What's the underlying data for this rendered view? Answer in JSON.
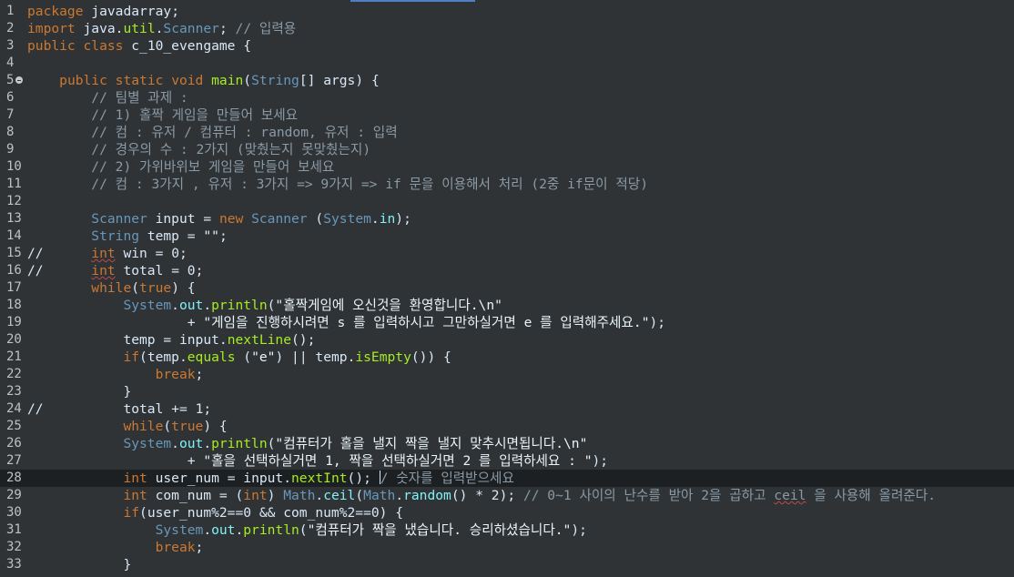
{
  "editor": {
    "language": "java",
    "current_line": 28,
    "lines": [
      {
        "n": "1",
        "t": "package javadarray;"
      },
      {
        "n": "2",
        "t": "import java.util.Scanner; // 입력용"
      },
      {
        "n": "3",
        "t": "public class c_10_evengame {"
      },
      {
        "n": "4",
        "t": ""
      },
      {
        "n": "5",
        "t": "    public static void main(String[] args) {"
      },
      {
        "n": "6",
        "t": "        // 팀별 과제 :"
      },
      {
        "n": "7",
        "t": "        // 1) 홀짝 게임을 만들어 보세요"
      },
      {
        "n": "8",
        "t": "        // 컴 : 유저 / 컴퓨터 : random, 유저 : 입력"
      },
      {
        "n": "9",
        "t": "        // 경우의 수 : 2가지 (맞췄는지 못맞췄는지)"
      },
      {
        "n": "10",
        "t": "        // 2) 가위바위보 게임을 만들어 보세요"
      },
      {
        "n": "11",
        "t": "        // 컴 : 3가지 , 유저 : 3가지 => 9가지 => if 문을 이용해서 처리 (2중 if문이 적당)"
      },
      {
        "n": "12",
        "t": ""
      },
      {
        "n": "13",
        "t": "        Scanner input = new Scanner (System.in);"
      },
      {
        "n": "14",
        "t": "        String temp = \"\";"
      },
      {
        "n": "15",
        "t": "//      int win = 0;"
      },
      {
        "n": "16",
        "t": "//      int total = 0;"
      },
      {
        "n": "17",
        "t": "        while(true) {"
      },
      {
        "n": "18",
        "t": "            System.out.println(\"홀짝게임에 오신것을 환영합니다.\\n\""
      },
      {
        "n": "19",
        "t": "                    + \"게임을 진행하시려면 s 를 입력하시고 그만하실거면 e 를 입력해주세요.\");"
      },
      {
        "n": "20",
        "t": "            temp = input.nextLine();"
      },
      {
        "n": "21",
        "t": "            if(temp.equals (\"e\") || temp.isEmpty()) {"
      },
      {
        "n": "22",
        "t": "                break;"
      },
      {
        "n": "23",
        "t": "            }"
      },
      {
        "n": "24",
        "t": "//          total += 1;"
      },
      {
        "n": "25",
        "t": "            while(true) {"
      },
      {
        "n": "26",
        "t": "            System.out.println(\"컴퓨터가 홀을 낼지 짝을 낼지 맞추시면됩니다.\\n\""
      },
      {
        "n": "27",
        "t": "                    + \"홀을 선택하실거면 1, 짝을 선택하실거면 2 를 입력하세요 : \");"
      },
      {
        "n": "28",
        "t": "            int user_num = input.nextInt(); // 숫자를 입력받으세요"
      },
      {
        "n": "29",
        "t": "            int com_num = (int) Math.ceil(Math.random() * 2); // 0~1 사이의 난수를 받아 2을 곱하고 ceil 을 사용해 올려준다."
      },
      {
        "n": "30",
        "t": "            if(user_num%2==0 && com_num%2==0) {"
      },
      {
        "n": "31",
        "t": "                System.out.println(\"컴퓨터가 짝을 냈습니다. 승리하셨습니다.\");"
      },
      {
        "n": "32",
        "t": "                break;"
      },
      {
        "n": "33",
        "t": "            }"
      }
    ]
  }
}
